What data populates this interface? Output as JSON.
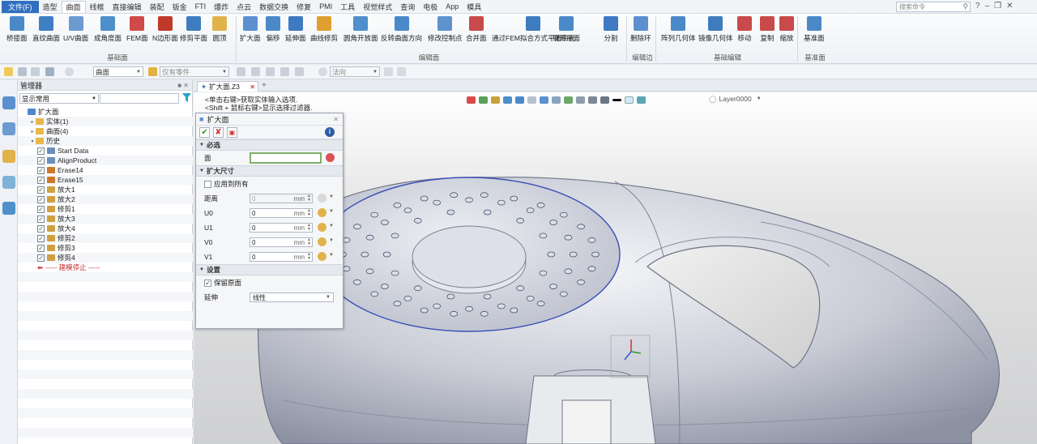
{
  "menubar": {
    "file_label": "文件(F)",
    "items": [
      "造型",
      "曲面",
      "线框",
      "直接编辑",
      "装配",
      "钣金",
      "FTI",
      "爆炸",
      "点云",
      "数据交换",
      "修复",
      "PMI",
      "工具",
      "视觉样式",
      "查询",
      "电极",
      "App",
      "模具"
    ],
    "active_index": 1,
    "search_placeholder": "搜索命令"
  },
  "ribbon": {
    "buttons": [
      {
        "label": "桥接面",
        "color": "#4a89c8"
      },
      {
        "label": "直纹曲面",
        "color": "#3f7fc4"
      },
      {
        "label": "U/V曲面",
        "color": "#6d9bd1"
      },
      {
        "label": "成角度面",
        "color": "#4d8fc9"
      },
      {
        "label": "FEM面",
        "color": "#d04a4a"
      },
      {
        "label": "N边形面",
        "color": "#c0392b"
      },
      {
        "label": "修剪平面",
        "color": "#3e7cc0"
      },
      {
        "label": "圆顶",
        "color": "#e0b34a"
      },
      {
        "label": "扩大面",
        "color": "#5b8fd0"
      },
      {
        "label": "偏移",
        "color": "#4a89c8"
      },
      {
        "label": "延伸面",
        "color": "#3d7ac2"
      },
      {
        "label": "曲线修剪",
        "color": "#e0a030"
      },
      {
        "label": "圆角开放面",
        "color": "#4f8fcc"
      },
      {
        "label": "反转曲面方向",
        "color": "#4a89c8"
      },
      {
        "label": "修改控制点",
        "color": "#5e93ce"
      },
      {
        "label": "合并面",
        "color": "#c94a4a"
      },
      {
        "label": "通过FEM拟合方式平滑曲面",
        "color": "#3e7cc0"
      },
      {
        "label": "展开平面",
        "color": "#4a89c8"
      },
      {
        "label": "分割",
        "color": "#3d7ac2"
      },
      {
        "label": "删除环",
        "color": "#5b8fd0"
      },
      {
        "label": "阵列几何体",
        "color": "#4a89c8"
      },
      {
        "label": "镜像几何体",
        "color": "#3e7cc0"
      },
      {
        "label": "移动",
        "color": "#c94a4a"
      },
      {
        "label": "复制",
        "color": "#c94a4a"
      },
      {
        "label": "缩放",
        "color": "#c94a4a"
      },
      {
        "label": "基准面",
        "color": "#4a89c8"
      }
    ],
    "groups": [
      "基础面",
      "编辑面",
      "编辑边",
      "基础编辑",
      "基准面"
    ]
  },
  "quick_toolbar": {
    "filter_combo": "曲面",
    "part_combo": "仅有零件",
    "direction_combo": "法向"
  },
  "manager": {
    "title": "管理器",
    "filter": "显示常用",
    "tree": [
      {
        "label": "扩大面",
        "level": 0,
        "kind": "root"
      },
      {
        "label": "实体(1)",
        "level": 1,
        "kind": "folder"
      },
      {
        "label": "曲面(4)",
        "level": 1,
        "kind": "folder"
      },
      {
        "label": "历史",
        "level": 1,
        "kind": "folder"
      },
      {
        "label": "Start Data",
        "level": 2,
        "kind": "item"
      },
      {
        "label": "AlignProduct",
        "level": 2,
        "kind": "item"
      },
      {
        "label": "Erase14",
        "level": 2,
        "kind": "item"
      },
      {
        "label": "Erase15",
        "level": 2,
        "kind": "item"
      },
      {
        "label": "放大1",
        "level": 2,
        "kind": "item"
      },
      {
        "label": "放大2",
        "level": 2,
        "kind": "item"
      },
      {
        "label": "修剪1",
        "level": 2,
        "kind": "item"
      },
      {
        "label": "放大3",
        "level": 2,
        "kind": "item"
      },
      {
        "label": "放大4",
        "level": 2,
        "kind": "item"
      },
      {
        "label": "修剪2",
        "level": 2,
        "kind": "item"
      },
      {
        "label": "修剪3",
        "level": 2,
        "kind": "item"
      },
      {
        "label": "修剪4",
        "level": 2,
        "kind": "item"
      },
      {
        "label": "----- 建模停止 -----",
        "level": 2,
        "kind": "stop"
      }
    ]
  },
  "document": {
    "tab_label": "扩大面.Z3",
    "hint_line1": "<单击右键>获取实体输入选项.",
    "hint_line2": "<Shift + 鼠标右键>显示选择过滤器.",
    "layer": "Layer0000"
  },
  "dialog": {
    "title": "扩大面",
    "required_section": "必选",
    "face_label": "面",
    "size_section": "扩大尺寸",
    "apply_all_label": "应用到所有",
    "distance_label": "距离",
    "distance_value": "0",
    "unit": "mm",
    "u0_label": "U0",
    "u0_value": "0",
    "u1_label": "U1",
    "u1_value": "0",
    "v0_label": "V0",
    "v0_value": "0",
    "v1_label": "V1",
    "v1_value": "0",
    "settings_section": "设置",
    "keep_original_label": "保留原面",
    "keep_original_checked": true,
    "extend_label": "延伸",
    "extend_value": "线性"
  }
}
